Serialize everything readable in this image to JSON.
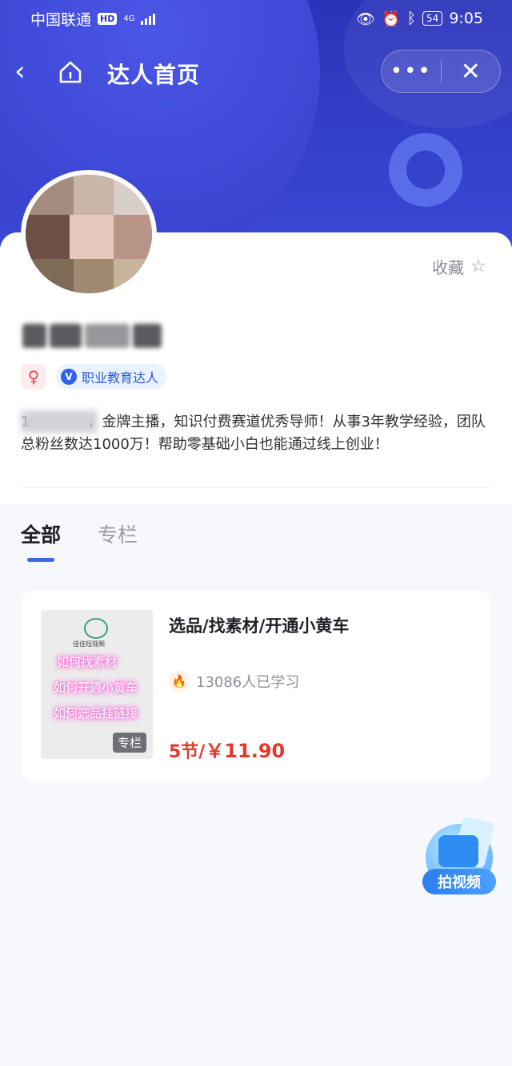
{
  "status": {
    "carrier": "中国联通",
    "hd": "HD",
    "network": "4G",
    "battery": "54",
    "time": "9:05"
  },
  "nav": {
    "title": "达人首页",
    "more": "•••",
    "close": "✕"
  },
  "profile": {
    "favorite_label": "收藏",
    "verified_tag": "职业教育达人",
    "bio": "1　　　　，金牌主播，知识付费赛道优秀导师！从事3年教学经验，团队总粉丝数达1000万！帮助零基础小白也能通过线上创业！"
  },
  "tabs": [
    {
      "label": "全部",
      "active": true
    },
    {
      "label": "专栏",
      "active": false
    }
  ],
  "products": [
    {
      "title": "选品/找素材/开通小黄车",
      "learners": "13086人已学习",
      "price_prefix": "5节/",
      "price": "￥11.90",
      "thumbnail": {
        "logo_text": "佳佳短视频",
        "lines": [
          "如何找素材",
          "如何开通小黄车",
          "如何选品挂链接"
        ],
        "badge": "专栏"
      }
    }
  ],
  "fab": {
    "label": "拍视频"
  },
  "colors": {
    "header": "#2e39c0",
    "accent": "#3e66e8",
    "price": "#e33a2c"
  }
}
